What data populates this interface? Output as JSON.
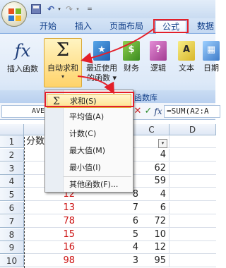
{
  "quick_access": {
    "undo_glyph": "↶",
    "redo_glyph": "↷",
    "dropdown_glyph": "▾",
    "customize_glyph": "="
  },
  "tabs": [
    {
      "label": "开始"
    },
    {
      "label": "插入"
    },
    {
      "label": "页面布局"
    },
    {
      "label": "公式",
      "active": true
    },
    {
      "label": "数据"
    }
  ],
  "ribbon": {
    "insert_function": {
      "icon": "fx-icon",
      "glyph": "fx",
      "label": "插入函数"
    },
    "autosum": {
      "icon": "sigma-icon",
      "glyph": "Σ",
      "label": "自动求和",
      "dropdown_glyph": "▾"
    },
    "recent": {
      "icon": "book-star-icon",
      "glyph": "★",
      "label_line1": "最近使用",
      "label_line2": "的函数 ▾"
    },
    "finance": {
      "icon": "book-money-icon",
      "glyph": "$",
      "label": "财务"
    },
    "logic": {
      "icon": "book-question-icon",
      "glyph": "?",
      "label": "逻辑"
    },
    "text": {
      "icon": "book-text-icon",
      "glyph": "A",
      "label": "文本"
    },
    "datetime": {
      "icon": "book-calendar-icon",
      "glyph": "▦",
      "label": "日期"
    },
    "group_label": "函数库"
  },
  "formula_bar": {
    "name_box": "AVE",
    "cancel_glyph": "✕",
    "enter_glyph": "✓",
    "fx_glyph": "fx",
    "formula": "=SUM(A2:A"
  },
  "grid": {
    "columns": [
      "C",
      "D"
    ],
    "rows": [
      {
        "num": "1",
        "a": "分数",
        "b": "",
        "c": ""
      },
      {
        "num": "2",
        "a": "",
        "b": "",
        "c": "4"
      },
      {
        "num": "3",
        "a": "",
        "b": "",
        "c": "62"
      },
      {
        "num": "4",
        "a": "",
        "b": "",
        "c": "59"
      },
      {
        "num": "5",
        "a": "12",
        "b": "8",
        "c": "4"
      },
      {
        "num": "6",
        "a": "13",
        "b": "7",
        "c": "6"
      },
      {
        "num": "7",
        "a": "78",
        "b": "6",
        "c": "72"
      },
      {
        "num": "8",
        "a": "15",
        "b": "5",
        "c": "10"
      },
      {
        "num": "9",
        "a": "16",
        "b": "4",
        "c": "12"
      },
      {
        "num": "10",
        "a": "98",
        "b": "3",
        "c": "95"
      }
    ],
    "filter_glyph": "▾",
    "colors": {
      "a_values": "#cc1111"
    }
  },
  "menu": {
    "items": [
      {
        "label": "求和(S)",
        "icon": "Σ"
      },
      {
        "label": "平均值(A)"
      },
      {
        "label": "计数(C)"
      },
      {
        "label": "最大值(M)"
      },
      {
        "label": "最小值(I)"
      },
      {
        "label": "其他函数(F)..."
      }
    ]
  },
  "colors": {
    "highlight_red": "#e3202a",
    "tab_text": "#15428b"
  }
}
